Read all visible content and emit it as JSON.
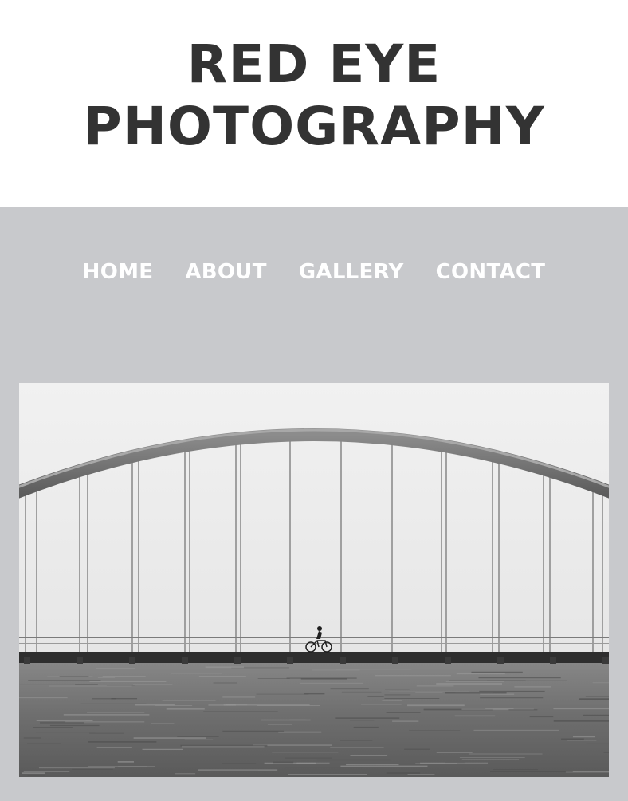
{
  "header": {
    "title_line1": "RED EYE",
    "title_line2": "PHOTOGRAPHY"
  },
  "nav": {
    "items": [
      {
        "label": "HOME"
      },
      {
        "label": "ABOUT"
      },
      {
        "label": "GALLERY"
      },
      {
        "label": "CONTACT"
      }
    ]
  },
  "hero": {
    "subject": "arch-bridge-over-water-with-cyclist"
  },
  "colors": {
    "title": "#333333",
    "nav_text": "#ffffff",
    "main_bg": "#c8c9cc"
  }
}
